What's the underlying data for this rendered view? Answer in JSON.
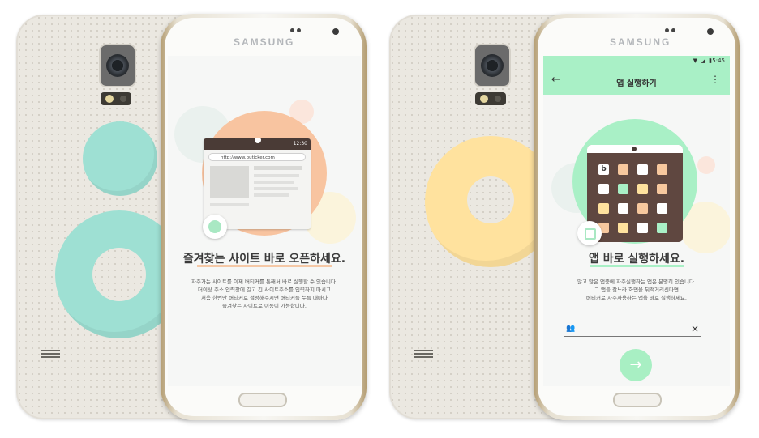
{
  "left_phone": {
    "brand": "SAMSUNG",
    "statusbar_time": "12:30",
    "url": "http://www.buticker.com",
    "headline": "즐겨찾는 사이트 바로 오픈하세요.",
    "body_lines": [
      "자주가는 사이트를 이제 버티커를 통해서 바로 실행할 수 있습니다.",
      "더이상 주소 입력창에 길고 긴 사이트주소를 입력하지 마시고",
      "처음 한번만 버티커로 설정해주시면 버티커를 누를 때마다",
      "즐겨찾는 사이트로 이동이 가능합니다."
    ],
    "icon": "compass-icon"
  },
  "right_phone": {
    "brand": "SAMSUNG",
    "statusbar_time": "15:45",
    "appbar_title": "앱 실행하기",
    "back_icon": "arrow-left-icon",
    "menu_icon": "more-vert-icon",
    "headline": "앱 바로 실행하세요.",
    "body_lines": [
      "많고 많은 앱중에 자주실행하는 앱은 분명히 있습니다.",
      "그 앱들 찾느라 화면을 뒤적거리신다면",
      "버티커로 자주사용하는 앱을 바로 실행하세요."
    ],
    "tablet_badge": "b",
    "input_value": "",
    "clear_label": "×",
    "go_label": "→",
    "icon": "open-in-new-icon"
  },
  "colors": {
    "mint": "#a9f0c6",
    "peach": "#f8c4a0",
    "teal_sticker": "#9ee0d3",
    "yellow_sticker": "#ffe29e"
  }
}
